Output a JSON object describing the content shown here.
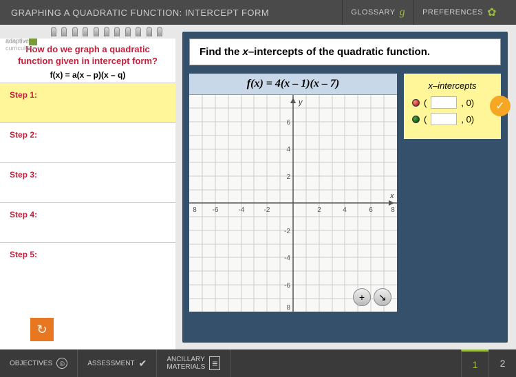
{
  "header": {
    "title": "GRAPHING A QUADRATIC FUNCTION: INTERCEPT FORM",
    "glossary": "GLOSSARY",
    "preferences": "PREFERENCES"
  },
  "logo": {
    "line1": "adaptive",
    "line2": "curriculum"
  },
  "notepad": {
    "question": "How do we graph a quadratic function given in intercept form?",
    "equation": "f(x) = a(x – p)(x – q)",
    "steps": [
      "Step 1:",
      "Step 2:",
      "Step 3:",
      "Step 4:",
      "Step 5:"
    ]
  },
  "prompt_prefix": "Find the ",
  "prompt_var": "x",
  "prompt_suffix": "–intercepts of the quadratic function.",
  "function_display": "f(x) = 4(x – 1)(x – 7)",
  "answer": {
    "title_var": "x",
    "title_suffix": "–intercepts",
    "row1_suffix": ", 0)",
    "row2_suffix": ", 0)"
  },
  "chart_data": {
    "type": "scatter",
    "title": "",
    "xlabel": "x",
    "ylabel": "y",
    "xlim": [
      -8,
      8
    ],
    "ylim": [
      -8,
      8
    ],
    "xticks": [
      -6,
      -4,
      -2,
      2,
      4,
      6
    ],
    "yticks": [
      -6,
      -4,
      -2,
      2,
      4,
      6
    ],
    "series": []
  },
  "footer": {
    "objectives": "OBJECTIVES",
    "assessment": "ASSESSMENT",
    "ancillary": "ANCILLARY",
    "materials": "MATERIALS",
    "page1": "1",
    "page2": "2"
  }
}
